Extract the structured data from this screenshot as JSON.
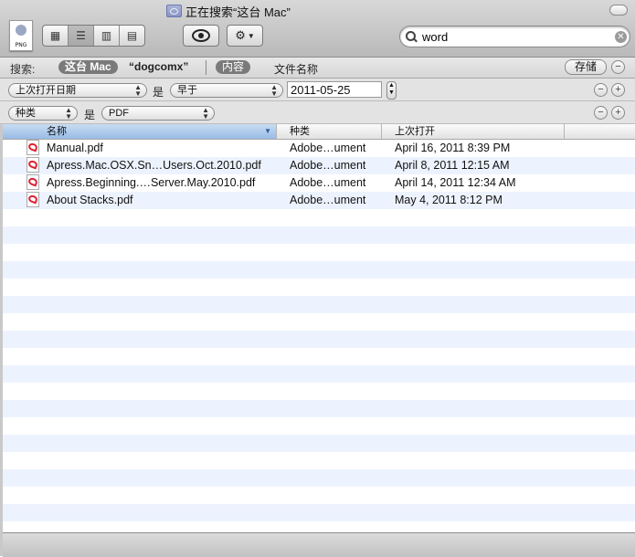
{
  "window": {
    "title": "正在搜索“这台 Mac”"
  },
  "toolbar": {
    "file_icon_label": "PNG",
    "view_modes": [
      "icon-view",
      "list-view",
      "column-view",
      "coverflow-view"
    ],
    "active_view": 1,
    "search": {
      "value": "word"
    }
  },
  "scope": {
    "label": "搜索:",
    "this_mac": "这台 Mac",
    "user_folder": "“dogcomx”",
    "content": "内容",
    "filename": "文件名称",
    "save": "存储"
  },
  "criteria": [
    {
      "attribute": "上次打开日期",
      "is": "是",
      "operator": "早于",
      "value": "2011-05-25"
    },
    {
      "attribute": "种类",
      "is": "是",
      "value": "PDF"
    }
  ],
  "columns": [
    "名称",
    "种类",
    "上次打开"
  ],
  "files": [
    {
      "name": "Manual.pdf",
      "kind": "Adobe…ument",
      "last_opened": "April 16, 2011 8:39 PM"
    },
    {
      "name": "Apress.Mac.OSX.Sn…Users.Oct.2010.pdf",
      "kind": "Adobe…ument",
      "last_opened": "April 8, 2011 12:15 AM"
    },
    {
      "name": "Apress.Beginning.…Server.May.2010.pdf",
      "kind": "Adobe…ument",
      "last_opened": "April 14, 2011 12:34 AM"
    },
    {
      "name": "About Stacks.pdf",
      "kind": "Adobe…ument",
      "last_opened": "May 4, 2011 8:12 PM"
    }
  ]
}
